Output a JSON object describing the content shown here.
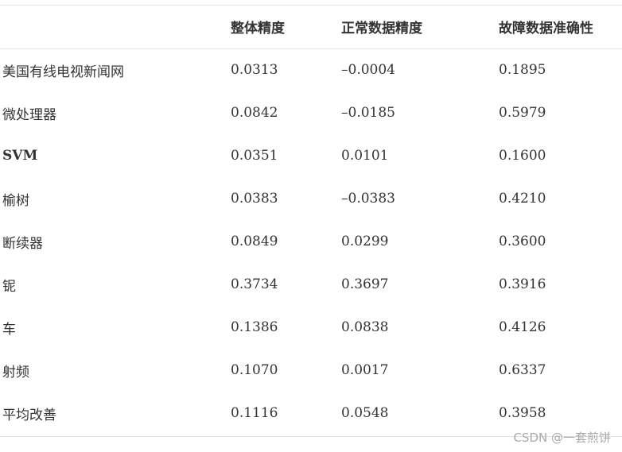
{
  "table": {
    "headers": [
      "",
      "整体精度",
      "正常数据精度",
      "故障数据准确性"
    ],
    "rows": [
      {
        "name": "美国有线电视新闻网",
        "overall": "0.0313",
        "normal": "–0.0004",
        "fault": "0.1895"
      },
      {
        "name": "微处理器",
        "overall": "0.0842",
        "normal": "–0.0185",
        "fault": "0.5979"
      },
      {
        "name": "SVM",
        "overall": "0.0351",
        "normal": "0.0101",
        "fault": "0.1600"
      },
      {
        "name": "榆树",
        "overall": "0.0383",
        "normal": "–0.0383",
        "fault": "0.4210"
      },
      {
        "name": "断续器",
        "overall": "0.0849",
        "normal": "0.0299",
        "fault": "0.3600"
      },
      {
        "name": "铌",
        "overall": "0.3734",
        "normal": "0.3697",
        "fault": "0.3916"
      },
      {
        "name": "车",
        "overall": "0.1386",
        "normal": "0.0838",
        "fault": "0.4126"
      },
      {
        "name": "射频",
        "overall": "0.1070",
        "normal": "0.0017",
        "fault": "0.6337"
      },
      {
        "name": "平均改善",
        "overall": "0.1116",
        "normal": "0.0548",
        "fault": "0.3958"
      }
    ]
  },
  "watermark": "CSDN @一套煎饼"
}
